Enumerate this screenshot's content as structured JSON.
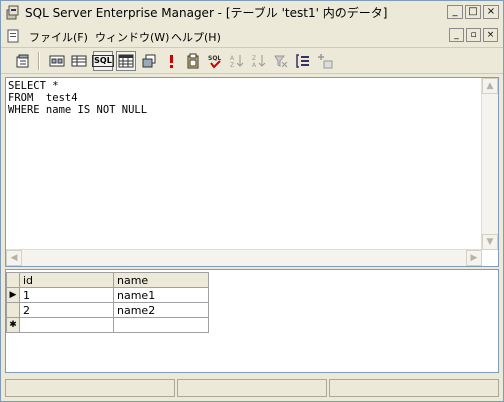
{
  "window": {
    "title": "SQL Server Enterprise Manager - [テーブル 'test1' 内のデータ]",
    "minimize_glyph": "_",
    "maximize_glyph": "□",
    "close_glyph": "×"
  },
  "menu": {
    "items": [
      {
        "label": "ファイル(F)"
      },
      {
        "label": "ウィンドウ(W)"
      },
      {
        "label": "ヘルプ(H)"
      }
    ],
    "mdi_minimize": "_",
    "mdi_restore": "▫",
    "mdi_close": "×"
  },
  "toolbar": {
    "sql_label": "SQL"
  },
  "sql": {
    "text": "SELECT *\nFROM  test4\nWHERE name IS NOT NULL"
  },
  "grid": {
    "columns": [
      "id",
      "name"
    ],
    "rows": [
      [
        "1",
        "name1"
      ],
      [
        "2",
        "name2"
      ]
    ],
    "current_row_marker": "▶",
    "new_row_marker": "✱"
  },
  "colors": {
    "accent": "#7f9db9",
    "error_red": "#cc0000"
  }
}
